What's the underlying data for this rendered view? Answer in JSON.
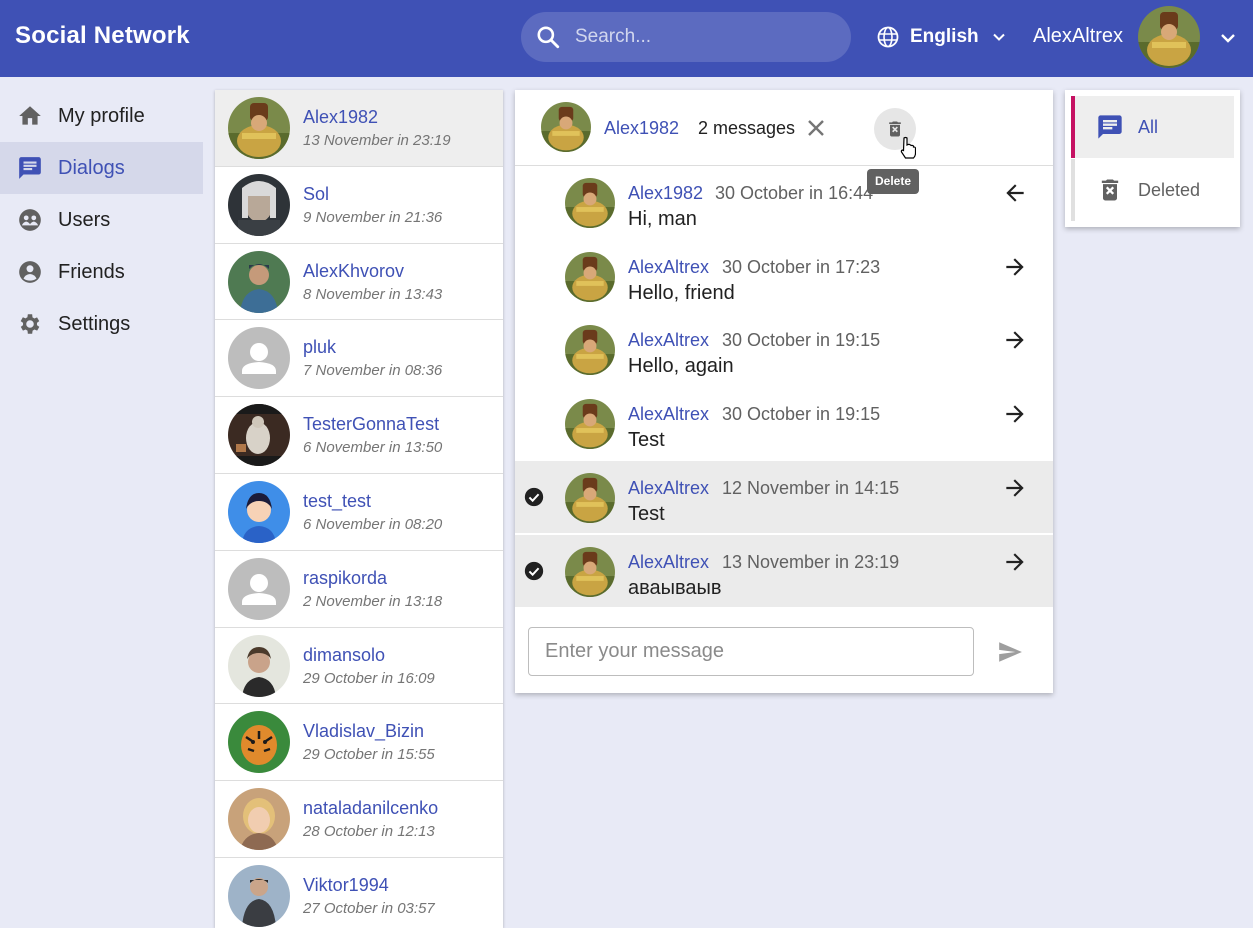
{
  "app": {
    "title": "Social Network"
  },
  "header": {
    "search_placeholder": "Search...",
    "language": "English",
    "username": "AlexAltrex"
  },
  "sidebar": {
    "items": [
      {
        "label": "My profile",
        "icon": "home-icon",
        "active": false
      },
      {
        "label": "Dialogs",
        "icon": "chat-icon",
        "active": true
      },
      {
        "label": "Users",
        "icon": "users-icon",
        "active": false
      },
      {
        "label": "Friends",
        "icon": "friends-icon",
        "active": false
      },
      {
        "label": "Settings",
        "icon": "gear-icon",
        "active": false
      }
    ]
  },
  "dialogs": [
    {
      "name": "Alex1982",
      "date": "13 November in 23:19",
      "selected": true,
      "avatar": "photo"
    },
    {
      "name": "Sol",
      "date": "9 November in 21:36",
      "avatar": "photo"
    },
    {
      "name": "AlexKhvorov",
      "date": "8 November in 13:43",
      "avatar": "photo"
    },
    {
      "name": "pluk",
      "date": "7 November in 08:36",
      "avatar": "default"
    },
    {
      "name": "TesterGonnaTest",
      "date": "6 November in 13:50",
      "avatar": "photo"
    },
    {
      "name": "test_test",
      "date": "6 November in 08:20",
      "avatar": "cartoon"
    },
    {
      "name": "raspikorda",
      "date": "2 November in 13:18",
      "avatar": "default"
    },
    {
      "name": "dimansolo",
      "date": "29 October in 16:09",
      "avatar": "photo"
    },
    {
      "name": "Vladislav_Bizin",
      "date": "29 October in 15:55",
      "avatar": "photo"
    },
    {
      "name": "nataladanilcenko",
      "date": "28 October in 12:13",
      "avatar": "photo"
    },
    {
      "name": "Viktor1994",
      "date": "27 October in 03:57",
      "avatar": "photo"
    }
  ],
  "chat": {
    "partner": "Alex1982",
    "selected_count": "2 messages",
    "tooltip": "Delete",
    "messages": [
      {
        "author": "Alex1982",
        "time": "30 October in 16:44",
        "text": "Hi, man",
        "direction": "incoming",
        "selected": false
      },
      {
        "author": "AlexAltrex",
        "time": "30 October in 17:23",
        "text": "Hello, friend",
        "direction": "outgoing",
        "selected": false
      },
      {
        "author": "AlexAltrex",
        "time": "30 October in 19:15",
        "text": "Hello, again",
        "direction": "outgoing",
        "selected": false
      },
      {
        "author": "AlexAltrex",
        "time": "30 October in 19:15",
        "text": "Test",
        "direction": "outgoing",
        "selected": false
      },
      {
        "author": "AlexAltrex",
        "time": "12 November in 14:15",
        "text": "Test",
        "direction": "outgoing",
        "selected": true
      },
      {
        "author": "AlexAltrex",
        "time": "13 November in 23:19",
        "text": "аваываыв",
        "direction": "outgoing",
        "selected": true
      }
    ],
    "input_placeholder": "Enter your message"
  },
  "filter": {
    "items": [
      {
        "label": "All",
        "icon": "chat-icon",
        "active": true
      },
      {
        "label": "Deleted",
        "icon": "delete-icon",
        "active": false
      }
    ]
  },
  "colors": {
    "primary": "#3f51b5",
    "accent": "#c51162",
    "background": "#e8eaf6"
  }
}
